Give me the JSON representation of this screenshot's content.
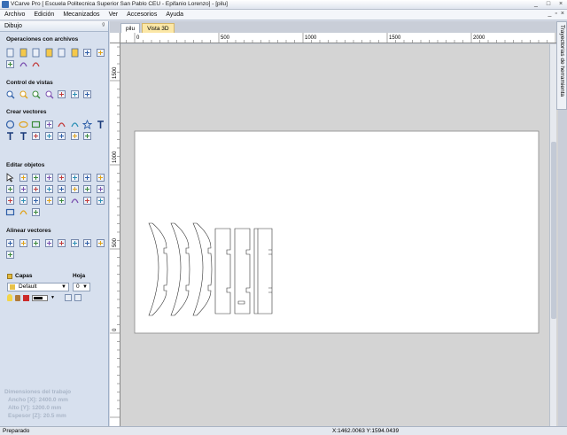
{
  "window": {
    "title": "VCarve Pro [ Escuela Politecnica Superior San Pablo CEU - Epifanio Lorenzo] - [pilu]",
    "controls": [
      "_",
      "□",
      "×"
    ]
  },
  "menu": {
    "items": [
      "Archivo",
      "Edición",
      "Mecanizados",
      "Ver",
      "Accesorios",
      "Ayuda"
    ],
    "mdi_controls": [
      "_",
      "▫",
      "×"
    ]
  },
  "panel": {
    "title": "Dibujo",
    "pin": "ᵍ",
    "sections": {
      "files": "Operaciones con archivos",
      "views": "Control de vistas",
      "vectors": "Crear vectores",
      "edit": "Editar objetos",
      "align": "Alinear vectores"
    },
    "layers": {
      "label": "Capas",
      "sheet_label": "Hoja",
      "layer_value": "Default",
      "sheet_value": "0"
    },
    "job": {
      "heading": "Dimensiones del trabajo",
      "width": "Ancho   [X]: 2400.0 mm",
      "height": "Alto    [Y]: 1200.0 mm",
      "thickness": "Espesor [Z]: 20.5 mm"
    }
  },
  "tabs": [
    "pilu",
    "Vista 3D"
  ],
  "side_tab": "Trayectorias de herramienta",
  "ruler": {
    "top_labels": [
      "0",
      "500",
      "1000",
      "1500",
      "2000"
    ],
    "left_labels": [
      "1500",
      "1000",
      "500",
      "0"
    ]
  },
  "status": {
    "text": "Preparado",
    "coords": "X:1462.0063 Y:1594.0439"
  },
  "icons": {
    "files": [
      "new-file-icon",
      "open-file-icon",
      "save-icon",
      "save-as-icon",
      "import-icon",
      "import-bitmap-icon",
      "cut-icon",
      "copy-icon",
      "paste-icon",
      "undo-icon",
      "redo-icon"
    ],
    "views": [
      "zoom-fit-icon",
      "zoom-in-icon",
      "zoom-window-icon",
      "zoom-out-icon",
      "view-2d-icon",
      "view-3d-icon",
      "view-split-icon"
    ],
    "vectors": [
      "circle-icon",
      "ellipse-icon",
      "rectangle-icon",
      "polyline-icon",
      "arc-icon",
      "curve-icon",
      "star-icon",
      "text-icon",
      "text-frame-icon",
      "text-arc-icon",
      "dimension-icon",
      "shape-icon",
      "bitmap-trace-icon",
      "grid-icon",
      "fill-pattern-icon"
    ],
    "edit": [
      "select-icon",
      "node-edit-icon",
      "transform-icon",
      "group-icon",
      "ungroup-icon",
      "move-icon",
      "scale-icon",
      "mirror-icon",
      "join-icon",
      "close-icon",
      "trim-icon",
      "offset-icon",
      "weld-icon",
      "subtract-icon",
      "intersect-icon",
      "array-icon",
      "fillet-icon",
      "smooth-icon",
      "extend-icon",
      "chamfer-icon",
      "break-icon",
      "curve-fit-icon",
      "measure-icon",
      "delete-icon",
      "rounded-rect-icon",
      "bend-icon",
      "snap-icon"
    ],
    "align": [
      "align-center-icon",
      "align-hcenter-icon",
      "align-vcenter-icon",
      "align-left-icon",
      "align-right-icon",
      "align-top-icon",
      "align-bottom-icon",
      "space-horizontal-icon",
      "space-vertical-icon"
    ]
  }
}
